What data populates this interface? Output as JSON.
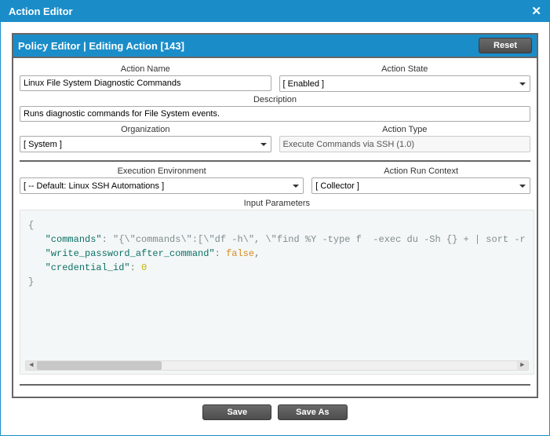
{
  "modal": {
    "title": "Action Editor"
  },
  "panel": {
    "title": "Policy Editor | Editing Action [143]",
    "reset": "Reset"
  },
  "labels": {
    "action_name": "Action Name",
    "action_state": "Action State",
    "description": "Description",
    "organization": "Organization",
    "action_type": "Action Type",
    "exec_env": "Execution Environment",
    "run_context": "Action Run Context",
    "input_params": "Input Parameters"
  },
  "fields": {
    "action_name": "Linux File System Diagnostic Commands",
    "action_state": "[ Enabled ]",
    "description": "Runs diagnostic commands for File System events.",
    "organization": "[ System ]",
    "action_type": "Execute Commands via SSH (1.0)",
    "exec_env": "[ -- Default: Linux SSH Automations ]",
    "run_context": "[ Collector ]"
  },
  "json_params": {
    "k1": "\"commands\"",
    "v1": "\"{\\\"commands\\\":[\\\"df -h\\\", \\\"find %Y -type f  -exec du -Sh {} + | sort -r",
    "k2": "\"write_password_after_command\"",
    "v2": "false",
    "k3": "\"credential_id\"",
    "v3": "0"
  },
  "footer": {
    "save": "Save",
    "save_as": "Save As"
  }
}
